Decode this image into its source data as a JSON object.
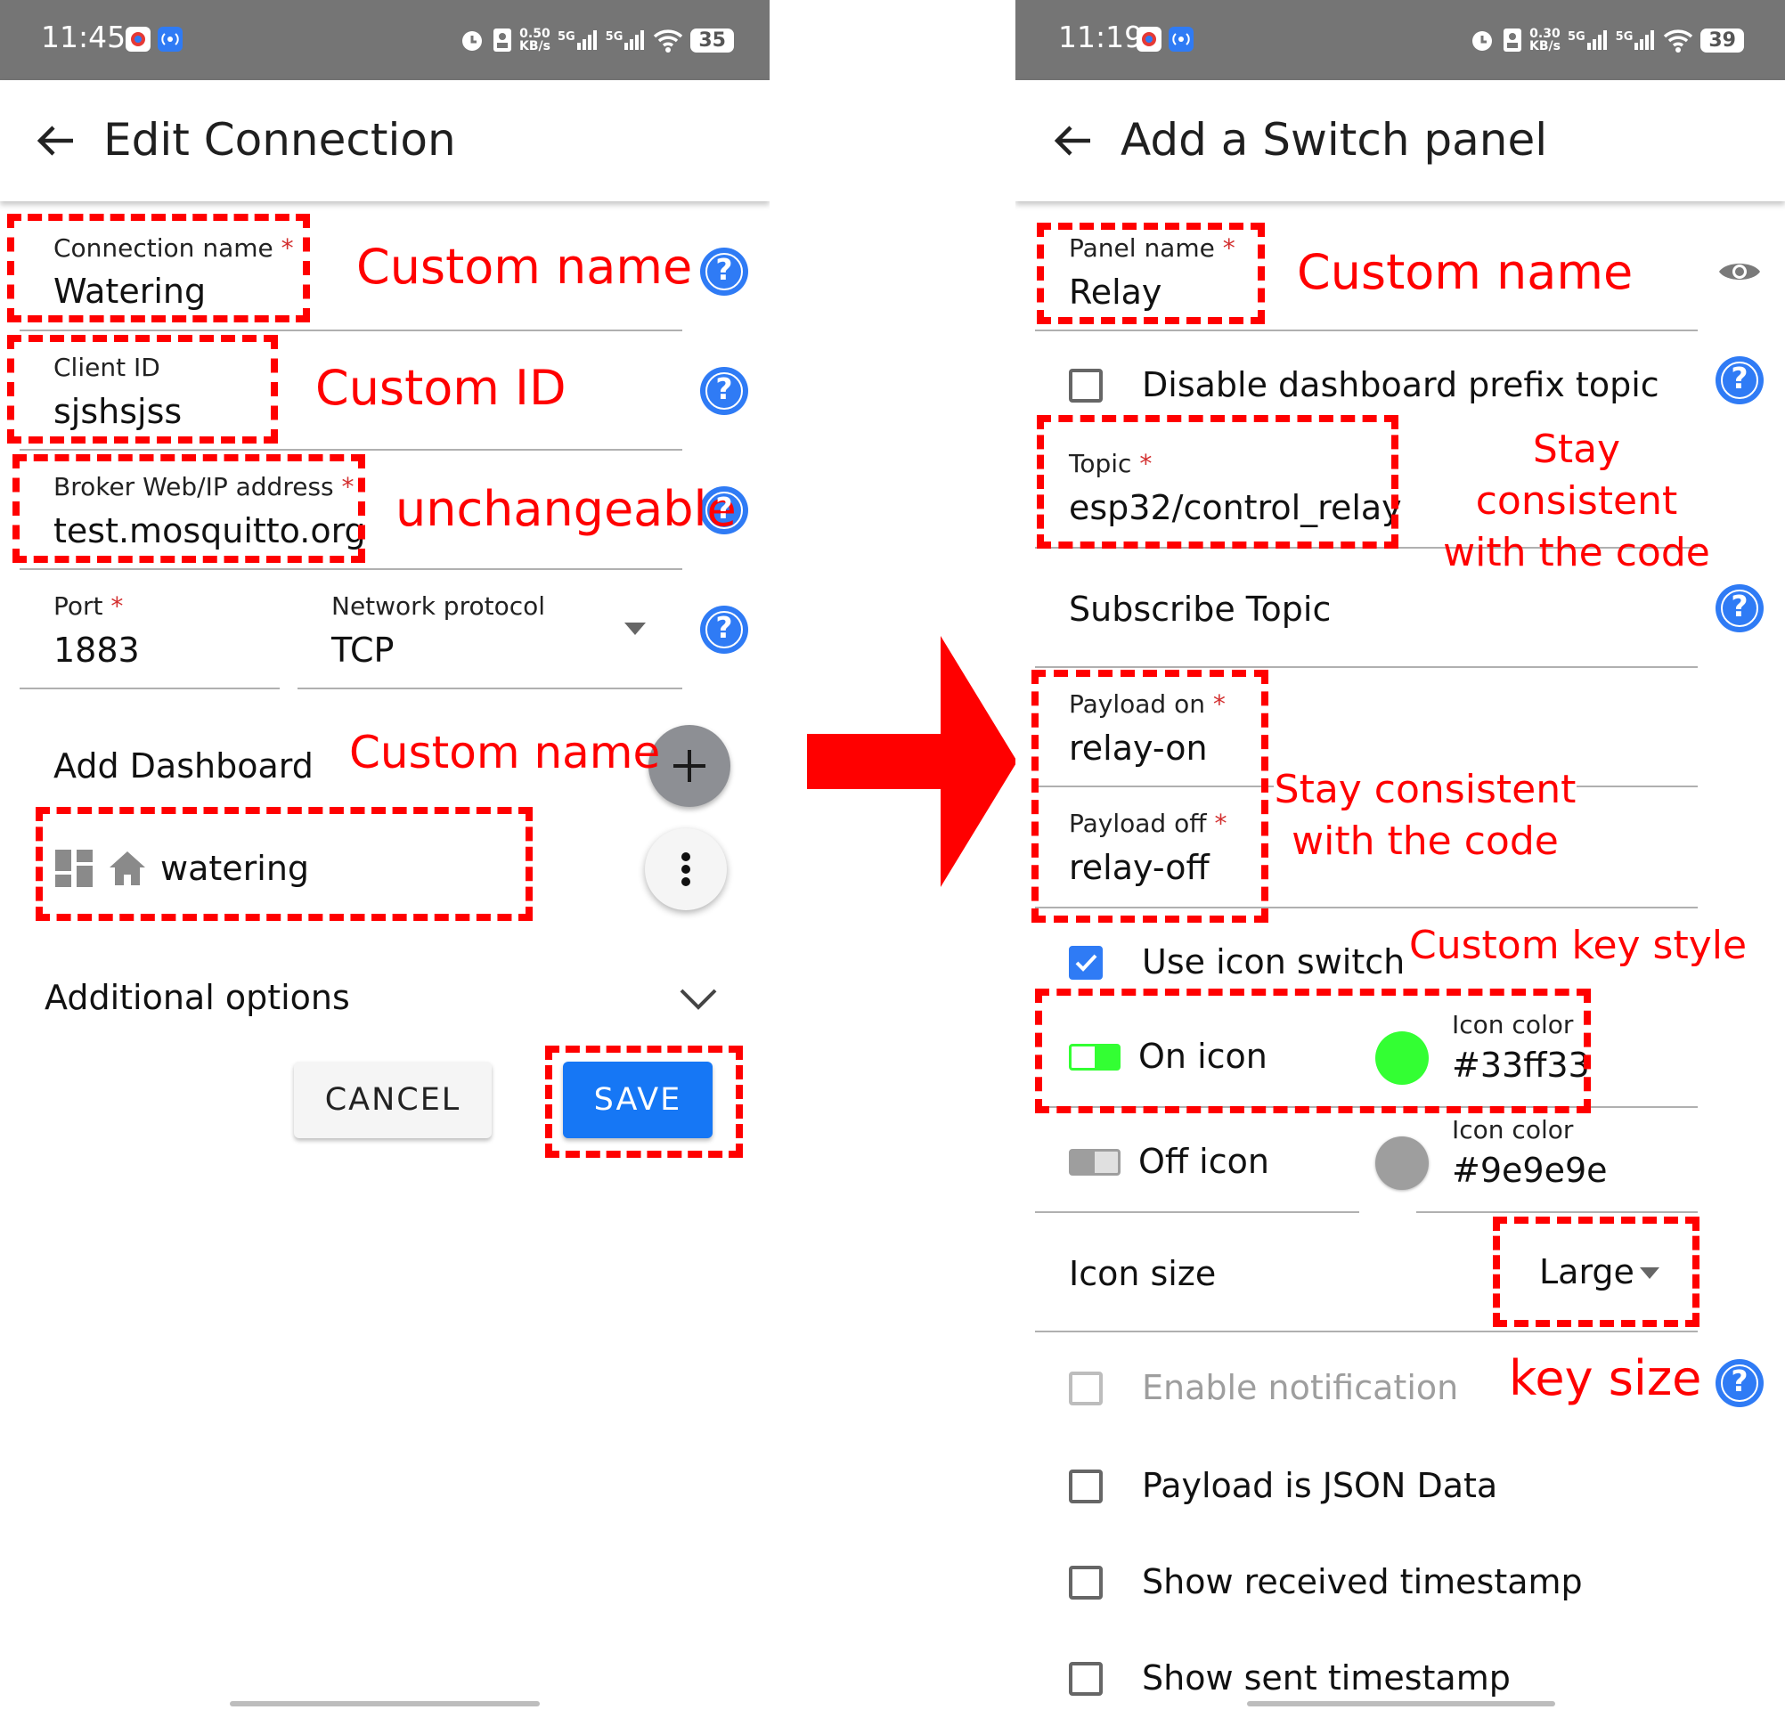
{
  "left": {
    "status": {
      "time": "11:45",
      "speed_top": "0.50",
      "speed_bottom": "KB/s",
      "net1": "5G",
      "net2": "5G",
      "battery": "35"
    },
    "title": "Edit Connection",
    "fields": {
      "connection_name_label": "Connection name",
      "connection_name_value": "Watering",
      "client_id_label": "Client ID",
      "client_id_value": "sjshsjss",
      "broker_label": "Broker Web/IP address",
      "broker_value": "test.mosquitto.org",
      "port_label": "Port",
      "port_value": "1883",
      "protocol_label": "Network protocol",
      "protocol_value": "TCP",
      "required_mark": "*"
    },
    "add_dashboard_label": "Add Dashboard",
    "dashboard_item": "watering",
    "additional_options": "Additional options",
    "cancel_label": "CANCEL",
    "save_label": "SAVE",
    "help_glyph": "?",
    "annotations": {
      "custom_name": "Custom name",
      "custom_id": "Custom ID",
      "unchangeable": "unchangeable",
      "custom_name_dashboard": "Custom name"
    }
  },
  "right": {
    "status": {
      "time": "11:19",
      "speed_top": "0.30",
      "speed_bottom": "KB/s",
      "net1": "5G",
      "net2": "5G",
      "battery": "39"
    },
    "title": "Add a Switch panel",
    "fields": {
      "panel_name_label": "Panel name",
      "panel_name_value": "Relay",
      "disable_prefix_label": "Disable dashboard prefix topic",
      "topic_label": "Topic",
      "topic_value": "esp32/control_relay",
      "subscribe_topic_label": "Subscribe Topic",
      "payload_on_label": "Payload on",
      "payload_on_value": "relay-on",
      "payload_off_label": "Payload off",
      "payload_off_value": "relay-off",
      "use_icon_switch_label": "Use icon switch",
      "on_icon_label": "On icon",
      "on_icon_color_label": "Icon color",
      "on_icon_color_value": "#33ff33",
      "off_icon_label": "Off icon",
      "off_icon_color_label": "Icon color",
      "off_icon_color_value": "#9e9e9e",
      "icon_size_label": "Icon size",
      "icon_size_value": "Large",
      "enable_notification_label": "Enable notification",
      "payload_json_label": "Payload is JSON Data",
      "show_received_label": "Show received timestamp",
      "show_sent_label": "Show sent timestamp",
      "required_mark": "*"
    },
    "annotations": {
      "custom_name": "Custom name",
      "stay_consistent_1a": "Stay consistent",
      "stay_consistent_1b": "with the code",
      "stay_consistent_2a": "Stay consistent",
      "stay_consistent_2b": "with the code",
      "custom_key_style": "Custom key style",
      "key_size": "key size"
    },
    "help_glyph": "?"
  },
  "colors": {
    "annotation_red": "#ff0000",
    "accent_blue": "#1677f5",
    "on_color": "#33ff33",
    "off_color": "#9e9e9e",
    "statusbar": "#757575"
  },
  "icons": [
    "back-arrow-icon",
    "help-icon",
    "dropdown-arrow-icon",
    "plus-icon",
    "more-vert-icon",
    "dashboard-icon",
    "home-icon",
    "chevron-down-icon",
    "eye-icon",
    "toggle-on-icon",
    "toggle-off-icon",
    "checkbox-icon",
    "right-arrow-icon"
  ]
}
